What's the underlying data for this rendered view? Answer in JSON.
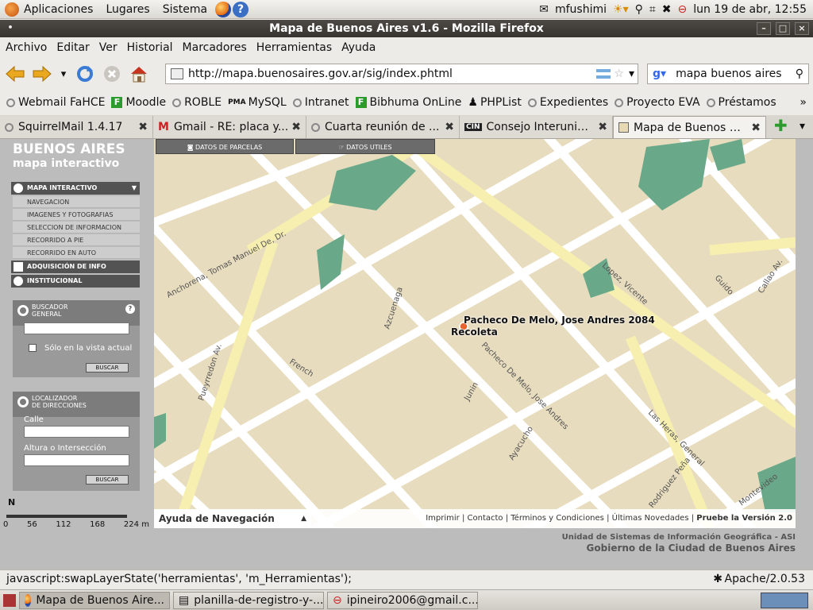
{
  "top_panel": {
    "menus": [
      "Aplicaciones",
      "Lugares",
      "Sistema"
    ],
    "user": "mfushimi",
    "datetime": "lun 19 de abr, 12:55"
  },
  "window": {
    "title": "Mapa de Buenos Aires v1.6 - Mozilla Firefox"
  },
  "menubar": [
    "Archivo",
    "Editar",
    "Ver",
    "Historial",
    "Marcadores",
    "Herramientas",
    "Ayuda"
  ],
  "navbar": {
    "url": "http://mapa.buenosaires.gov.ar/sig/index.phtml",
    "search": "mapa buenos aires"
  },
  "bookmarks": [
    "Webmail FaHCE",
    "Moodle",
    "ROBLE",
    "MySQL",
    "Intranet",
    "Bibhuma OnLine",
    "PHPList",
    "Expedientes",
    "Proyecto EVA",
    "Préstamos"
  ],
  "tabs": [
    {
      "label": "SquirrelMail 1.4.17",
      "active": false
    },
    {
      "label": "Gmail - RE: placa y...",
      "active": false
    },
    {
      "label": "Cuarta reunión de ...",
      "active": false
    },
    {
      "label": "Consejo Interunive...",
      "active": false
    },
    {
      "label": "Mapa de Buenos Ai...",
      "active": true
    }
  ],
  "sidebar": {
    "brand_title": "BUENOS AIRES",
    "brand_subtitle": "mapa interactivo",
    "section_main": "MAPA INTERACTIVO",
    "items": [
      "NAVEGACION",
      "IMAGENES Y FOTOGRAFIAS",
      "SELECCION DE INFORMACION",
      "RECORRIDO A PIE",
      "RECORRIDO EN AUTO"
    ],
    "section_acq": "ADQUISICIÓN DE INFO",
    "section_inst": "INSTITUCIONAL",
    "buscador": {
      "title_1": "BUSCADOR",
      "title_2": "GENERAL",
      "help": "?",
      "checkbox": "Sólo en la vista actual",
      "button": "BUSCAR"
    },
    "localizador": {
      "title_1": "LOCALIZADOR",
      "title_2": "DE DIRECCIONES",
      "calle_label": "Calle",
      "altura_label": "Altura o Intersección",
      "button": "BUSCAR"
    },
    "scale": {
      "north": "N",
      "ticks": [
        "0",
        "56",
        "112",
        "168",
        "224"
      ],
      "unit": "m"
    }
  },
  "map": {
    "tabs": [
      "DATOS DE PARCELAS",
      "DATOS UTILES"
    ],
    "address_label": "Pacheco De Melo, Jose Andres 2084",
    "barrio_label": "Recoleta",
    "street_labels": [
      "Anchorena, Tomas Manuel De, Dr.",
      "Pueyrredon Av.",
      "Azcuenaga",
      "French",
      "Pacheco De Melo, Jose Andres",
      "Junin",
      "Ayacucho",
      "Lopez, Vicente",
      "Guido",
      "Callao Av.",
      "Las Heras, General",
      "Rodriguez Peña",
      "Montevideo"
    ],
    "footer_help": "Ayuda de Navegación",
    "footer_links": [
      "Imprimir",
      "Contacto",
      "Términos y Condiciones",
      "Últimas Novedades",
      "Pruebe la Versión 2.0"
    ]
  },
  "credits": {
    "line1": "Unidad de Sistemas de Información Geográfica - ASI",
    "line2": "Gobierno de la Ciudad de Buenos Aires"
  },
  "status": {
    "text": "javascript:swapLayerState('herramientas', 'm_Herramientas');",
    "server": "Apache/2.0.53"
  },
  "taskbar": [
    "Mapa de Buenos Aire...",
    "planilla-de-registro-y-...",
    "ipineiro2006@gmail.c..."
  ]
}
